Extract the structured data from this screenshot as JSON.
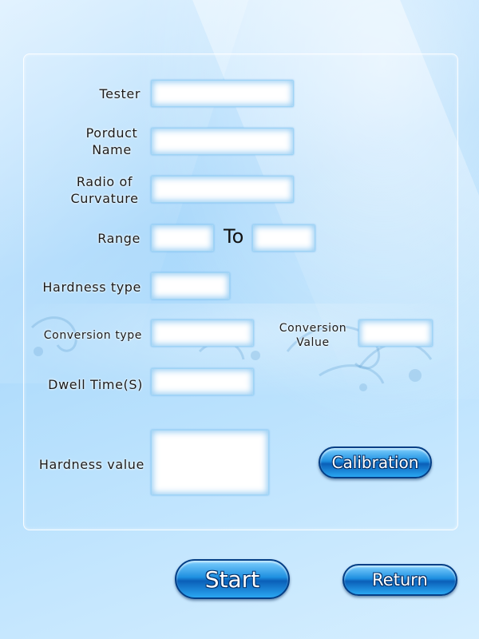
{
  "form": {
    "tester_label": "Tester",
    "product_name_label_1": "Porduct",
    "product_name_label_2": "Name",
    "radius_label_1": "Radio of",
    "radius_label_2": "Curvature",
    "range_label": "Range",
    "range_to_label": "To",
    "hardness_type_label": "Hardness type",
    "conversion_type_label": "Conversion type",
    "conversion_value_label_1": "Conversion",
    "conversion_value_label_2": "Value",
    "dwell_time_label": "Dwell Time(S)",
    "hardness_value_label": "Hardness value",
    "tester_value": "",
    "product_name_value": "",
    "radius_value": "",
    "range_from_value": "",
    "range_to_value": "",
    "hardness_type_value": "",
    "conversion_type_value": "",
    "conversion_value_value": "",
    "dwell_time_value": "",
    "hardness_value_value": ""
  },
  "buttons": {
    "calibration_label": "Calibration",
    "start_label": "Start",
    "return_label": "Return"
  }
}
